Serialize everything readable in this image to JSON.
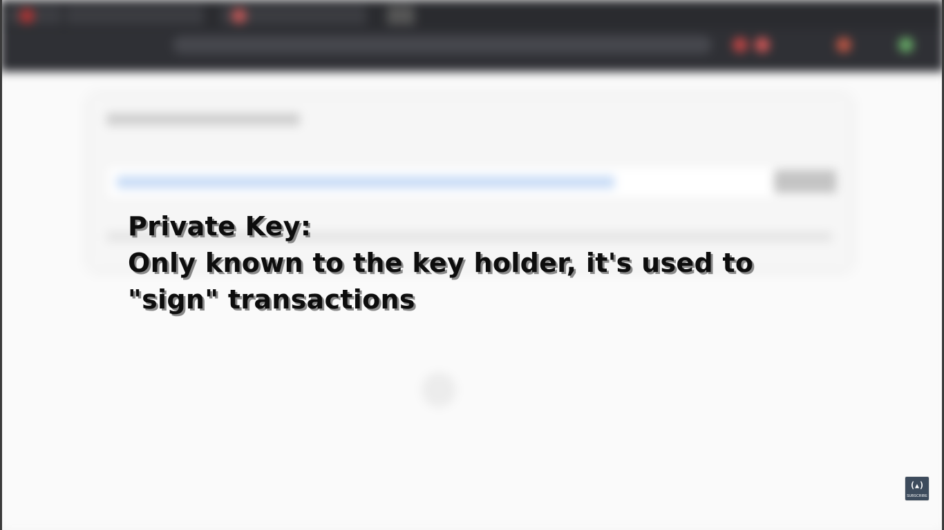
{
  "caption": {
    "line1": "Private Key:",
    "line2": "Only known to the key holder, it's used to",
    "line3": "\"sign\" transactions"
  },
  "badge": {
    "icon": "freecodecamp-icon",
    "glyph": "(🔥)",
    "label": "SUBSCRIBE"
  },
  "colors": {
    "caption_text": "#0d0d0d",
    "caption_shadow": "#8a8a8a",
    "badge_bg": "#3d4b5c",
    "highlight": "#c8dcf6"
  }
}
